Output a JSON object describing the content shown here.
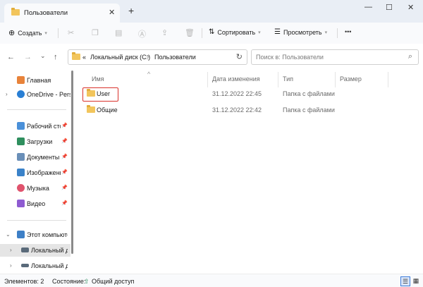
{
  "window": {
    "tab_title": "Пользователи",
    "tab_close": "✕",
    "new_tab": "+",
    "minimize": "—",
    "maximize": "☐",
    "close": "✕"
  },
  "toolbar": {
    "create_label": "Создать",
    "sort_label": "Сортировать",
    "view_label": "Просмотреть",
    "more": "•••"
  },
  "address": {
    "overflow": "«",
    "crumbs": [
      "Локальный диск (C:)",
      "Пользователи"
    ],
    "separator": ">",
    "search_placeholder": "Поиск в: Пользователи"
  },
  "nav": {
    "back": "←",
    "forward": "→",
    "recent": "⌄",
    "up": "↑",
    "items": [
      {
        "label": "Главная"
      },
      {
        "label": "OneDrive - Perso"
      },
      {
        "label": "Рабочий сто"
      },
      {
        "label": "Загрузки"
      },
      {
        "label": "Документы"
      },
      {
        "label": "Изображени"
      },
      {
        "label": "Музыка"
      },
      {
        "label": "Видео"
      },
      {
        "label": "Этот компьюте"
      },
      {
        "label": "Локальный ди"
      },
      {
        "label": "Локальный ди"
      }
    ]
  },
  "columns": {
    "name": "Имя",
    "date": "Дата изменения",
    "type": "Тип",
    "size": "Размер"
  },
  "files": [
    {
      "name": "User",
      "date": "31.12.2022 22:45",
      "type": "Папка с файлами"
    },
    {
      "name": "Общие",
      "date": "31.12.2022 22:42",
      "type": "Папка с файлами"
    }
  ],
  "status": {
    "count": "Элементов: 2",
    "state_label": "Состояние:",
    "state_value": "Общий доступ"
  },
  "colors": {
    "folder": "#f2c55c",
    "highlight": "#d9312b",
    "accent": "#3b7ad9"
  },
  "icons": {
    "folder": "folder-icon",
    "search": "search-icon",
    "refresh": "refresh-icon",
    "home": "home-icon",
    "onedrive": "cloud-icon",
    "pin": "pin-icon"
  }
}
